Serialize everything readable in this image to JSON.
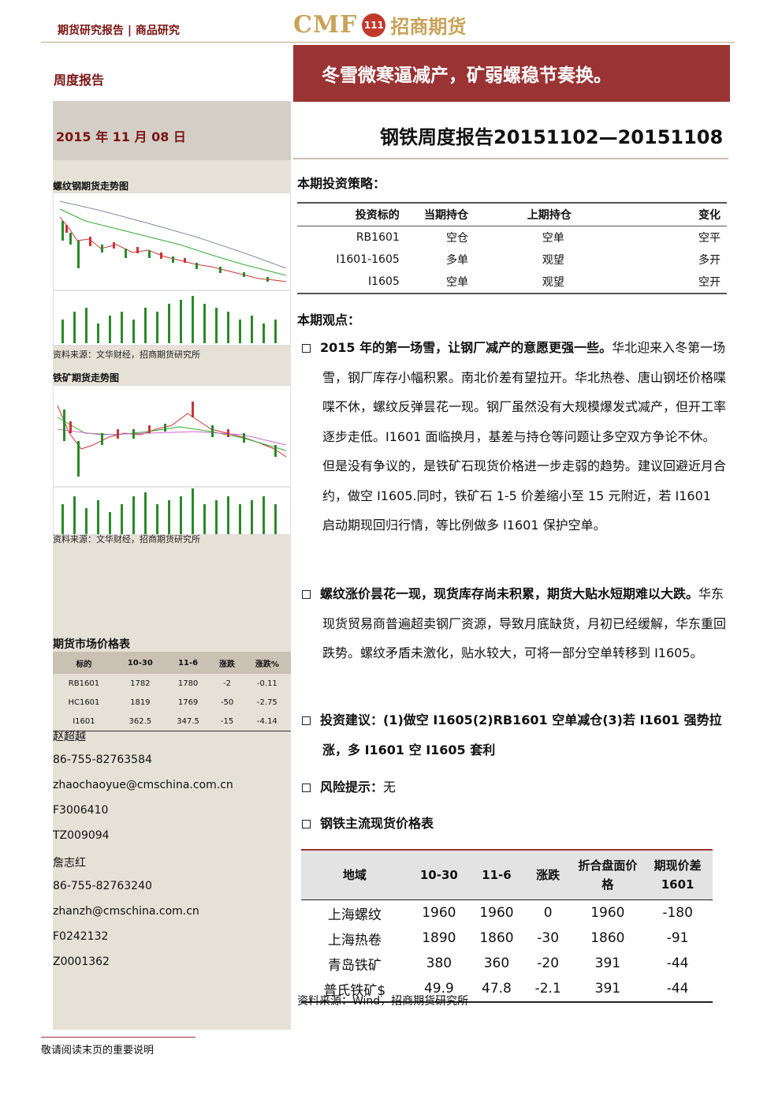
{
  "header": {
    "category": "期货研究报告 | 商品研究",
    "logo_text": "CMF",
    "logo_badge": "111",
    "logo_cn": "招商期货"
  },
  "sidebar": {
    "report_type": "周度报告",
    "date": "2015 年 11 月 08 日",
    "chart1_title": "螺纹钢期货走势图",
    "chart1_source": "资料来源：文华财经，招商期货研究所",
    "chart2_title": "铁矿期货走势图",
    "chart2_source": "资料来源：文华财经，招商期货研究所",
    "market_title": "期货市场价格表",
    "market_headers": [
      "标的",
      "10-30",
      "11-6",
      "涨跌",
      "涨跌%"
    ],
    "market_rows": [
      [
        "RB1601",
        "1782",
        "1780",
        "-2",
        "-0.11"
      ],
      [
        "HC1601",
        "1819",
        "1769",
        "-50",
        "-2.75"
      ],
      [
        "I1601",
        "362.5",
        "347.5",
        "-15",
        "-4.14"
      ]
    ],
    "contacts": [
      "赵超越",
      "86-755-82763584",
      "zhaochaoyue@cmschina.com.cn",
      "F3006410",
      "TZ009094",
      "詹志红",
      "86-755-82763240",
      "zhanzh@cmschina.com.cn",
      "F0242132",
      "Z0001362"
    ]
  },
  "main": {
    "headline": "冬雪微寒逼减产，矿弱螺稳节奏换。",
    "report_title": "钢铁周度报告20151102—20151108",
    "strategy_title": "本期投资策略：",
    "strategy_headers": [
      "投资标的",
      "当期持仓",
      "上期持仓",
      "变化"
    ],
    "strategy_rows": [
      [
        "RB1601",
        "空仓",
        "空单",
        "空平"
      ],
      [
        "I1601-1605",
        "多单",
        "观望",
        "多开"
      ],
      [
        "I1605",
        "空单",
        "观望",
        "空开"
      ]
    ],
    "views_title": "本期观点：",
    "b1_bold": "2015 年的第一场雪，让钢厂减产的意愿更强一些。",
    "b1_text": "华北迎来入冬第一场雪，钢厂库存小幅积累。南北价差有望拉开。华北热卷、唐山钢坯价格喋喋不休，螺纹反弹昙花一现。钢厂虽然没有大规模爆发式减产，但开工率逐步走低。I1601 面临换月，基差与持仓等问题让多空双方争论不休。但是没有争议的，是铁矿石现货价格进一步走弱的趋势。建议回避近月合约，做空 I1605.同时，铁矿石 1-5 价差缩小至 15 元附近，若 I1601 启动期现回归行情，等比例做多 I1601 保护空单。",
    "b2_bold": "螺纹涨价昙花一现，现货库存尚未积累，期货大贴水短期难以大跌。",
    "b2_text": "华东现货贸易商普遍超卖钢厂资源，导致月底缺货，月初已经缓解，华东重回跌势。螺纹矛盾未激化，贴水较大，可将一部分空单转移到 I1605。",
    "b3_bold": "投资建议：(1)做空 I1605(2)RB1601 空单减仓(3)若 I1601 强势拉涨，多 I1601 空 I1605 套利",
    "b4_bold": "风险提示：",
    "b4_text": "无",
    "b5_bold": "钢铁主流现货价格表",
    "spot_headers": [
      "地域",
      "10-30",
      "11-6",
      "涨跌",
      "折合盘面价格",
      "期现价差1601"
    ],
    "spot_rows": [
      [
        "上海螺纹",
        "1960",
        "1960",
        "0",
        "1960",
        "-180"
      ],
      [
        "上海热卷",
        "1890",
        "1860",
        "-30",
        "1860",
        "-91"
      ],
      [
        "青岛铁矿",
        "380",
        "360",
        "-20",
        "391",
        "-44"
      ],
      [
        "普氏铁矿$",
        "49.9",
        "47.8",
        "-2.1",
        "391",
        "-44"
      ]
    ],
    "spot_source": "资料来源：Wind，招商期货研究所"
  },
  "footer": {
    "note": "敬请阅读末页的重要说明"
  },
  "colors": {
    "brand": "#9a3434",
    "gold": "#c9a35a",
    "sidebar": "#e6e1d7"
  }
}
